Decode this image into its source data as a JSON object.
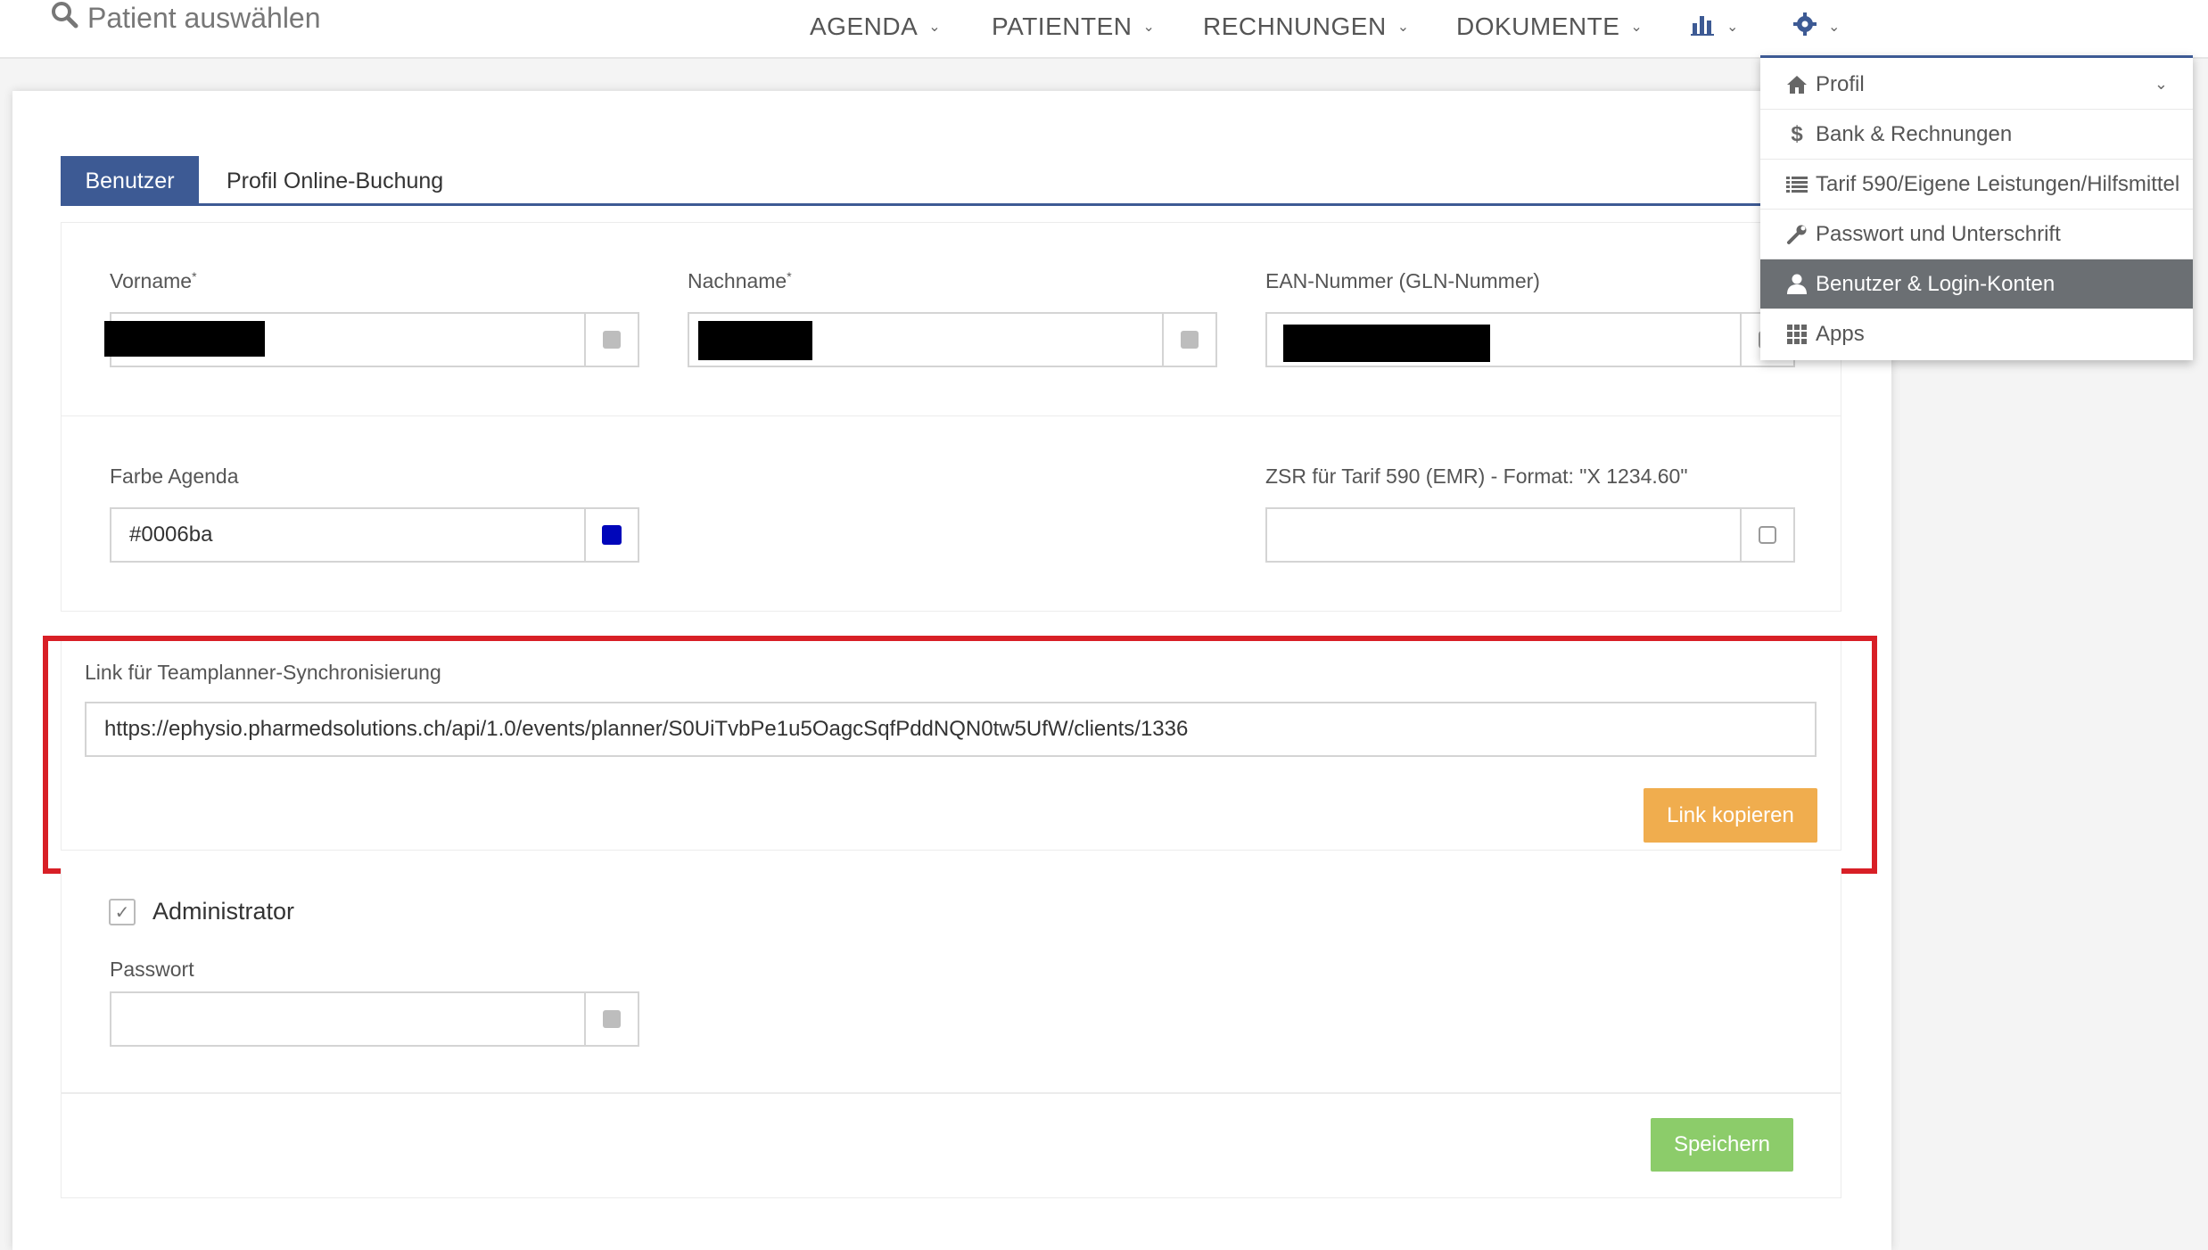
{
  "nav": {
    "search_label": "Patient auswählen",
    "items": [
      "AGENDA",
      "PATIENTEN",
      "RECHNUNGEN",
      "DOKUMENTE"
    ],
    "stats_icon": "bar-chart-icon",
    "settings_icon": "gear-icon"
  },
  "tabs": {
    "active": "Benutzer",
    "other": "Profil Online-Buchung"
  },
  "form": {
    "vorname_label": "Vorname",
    "nachname_label": "Nachname",
    "required_mark": "*",
    "ean_label": "EAN-Nummer (GLN-Nummer)",
    "farbe_label": "Farbe Agenda",
    "farbe_value": "#0006ba",
    "zsr_label": "ZSR für Tarif 590 (EMR) - Format: \"X 1234.60\"",
    "zsr_value": "",
    "link_label": "Link für Teamplanner-Synchronisierung",
    "link_value": "https://ephysio.pharmedsolutions.ch/api/1.0/events/planner/S0UiTvbPe1u5OagcSqfPddNQN0tw5UfW/clients/1336",
    "copy_button": "Link kopieren",
    "admin_label": "Administrator",
    "admin_checked": true,
    "password_label": "Passwort",
    "password_value": "",
    "save_button": "Speichern"
  },
  "menu": {
    "items": [
      {
        "label": "Profil",
        "icon": "home-icon",
        "active": false
      },
      {
        "label": "Bank & Rechnungen",
        "icon": "dollar-icon",
        "active": false
      },
      {
        "label": "Tarif 590/Eigene Leistungen/Hilfsmittel",
        "icon": "list-icon",
        "active": false
      },
      {
        "label": "Passwort und Unterschrift",
        "icon": "wrench-icon",
        "active": false
      },
      {
        "label": "Benutzer & Login-Konten",
        "icon": "user-icon",
        "active": true
      },
      {
        "label": "Apps",
        "icon": "grid-icon",
        "active": false
      }
    ]
  },
  "colors": {
    "primary": "#3d5a94",
    "highlight": "#d81f26",
    "copy_button": "#f0ad4e",
    "save_button": "#8ccc6a",
    "active_menu": "#6b6f73",
    "agenda_swatch": "#0006ba"
  }
}
